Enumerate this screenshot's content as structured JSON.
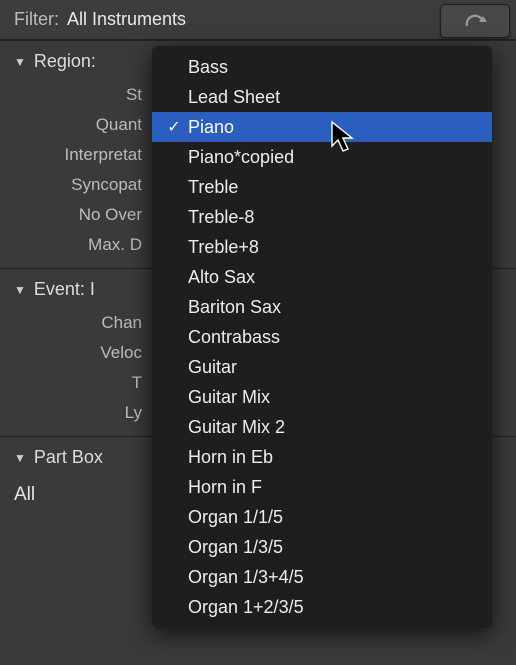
{
  "filter": {
    "label": "Filter:",
    "value": "All Instruments"
  },
  "sections": {
    "region": {
      "title": "Region:",
      "params": [
        "St",
        "Quant",
        "Interpretat",
        "Syncopat",
        "No Over",
        "Max. D"
      ]
    },
    "event": {
      "title": "Event:  I",
      "params": [
        "Chan",
        "Veloc",
        "T",
        "Ly"
      ]
    },
    "partbox": {
      "title": "Part Box",
      "all": "All"
    }
  },
  "menu": {
    "items": [
      "Bass",
      "Lead Sheet",
      "Piano",
      "Piano*copied",
      "Treble",
      "Treble-8",
      "Treble+8",
      "Alto Sax",
      "Bariton Sax",
      "Contrabass",
      "Guitar",
      "Guitar Mix",
      "Guitar Mix 2",
      "Horn in Eb",
      "Horn in F",
      "Organ 1/1/5",
      "Organ 1/3/5",
      "Organ 1/3+4/5",
      "Organ 1+2/3/5"
    ],
    "selected_index": 2
  }
}
